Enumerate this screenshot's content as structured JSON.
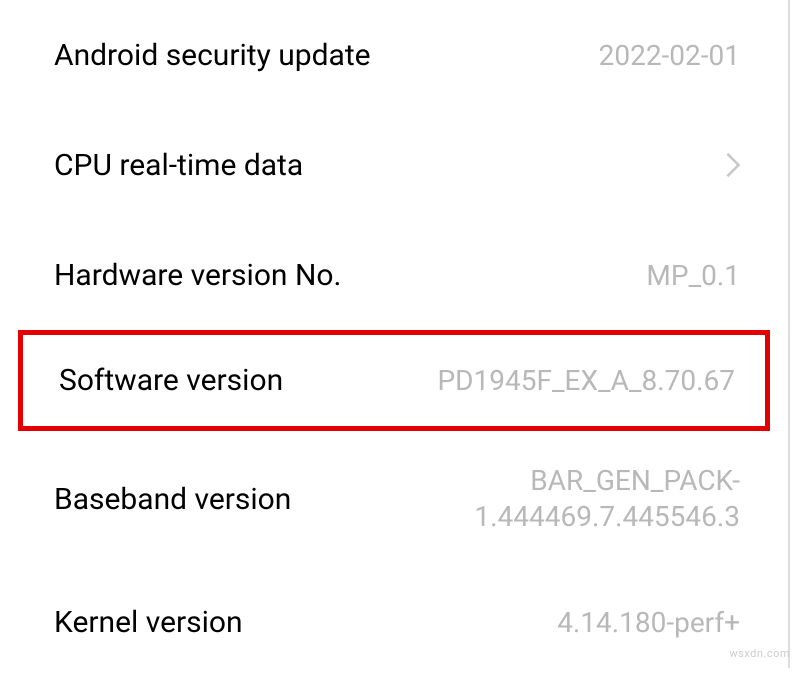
{
  "rows": {
    "security_update": {
      "label": "Android security update",
      "value": "2022-02-01"
    },
    "cpu_data": {
      "label": "CPU real-time data"
    },
    "hardware_version": {
      "label": "Hardware version No.",
      "value": "MP_0.1"
    },
    "software_version": {
      "label": "Software version",
      "value": "PD1945F_EX_A_8.70.67"
    },
    "baseband_version": {
      "label": "Baseband version",
      "value": "BAR_GEN_PACK-1.444469.7.445546.3"
    },
    "kernel_version": {
      "label": "Kernel version",
      "value": "4.14.180-perf+"
    }
  },
  "watermark": "wsxdn.com"
}
